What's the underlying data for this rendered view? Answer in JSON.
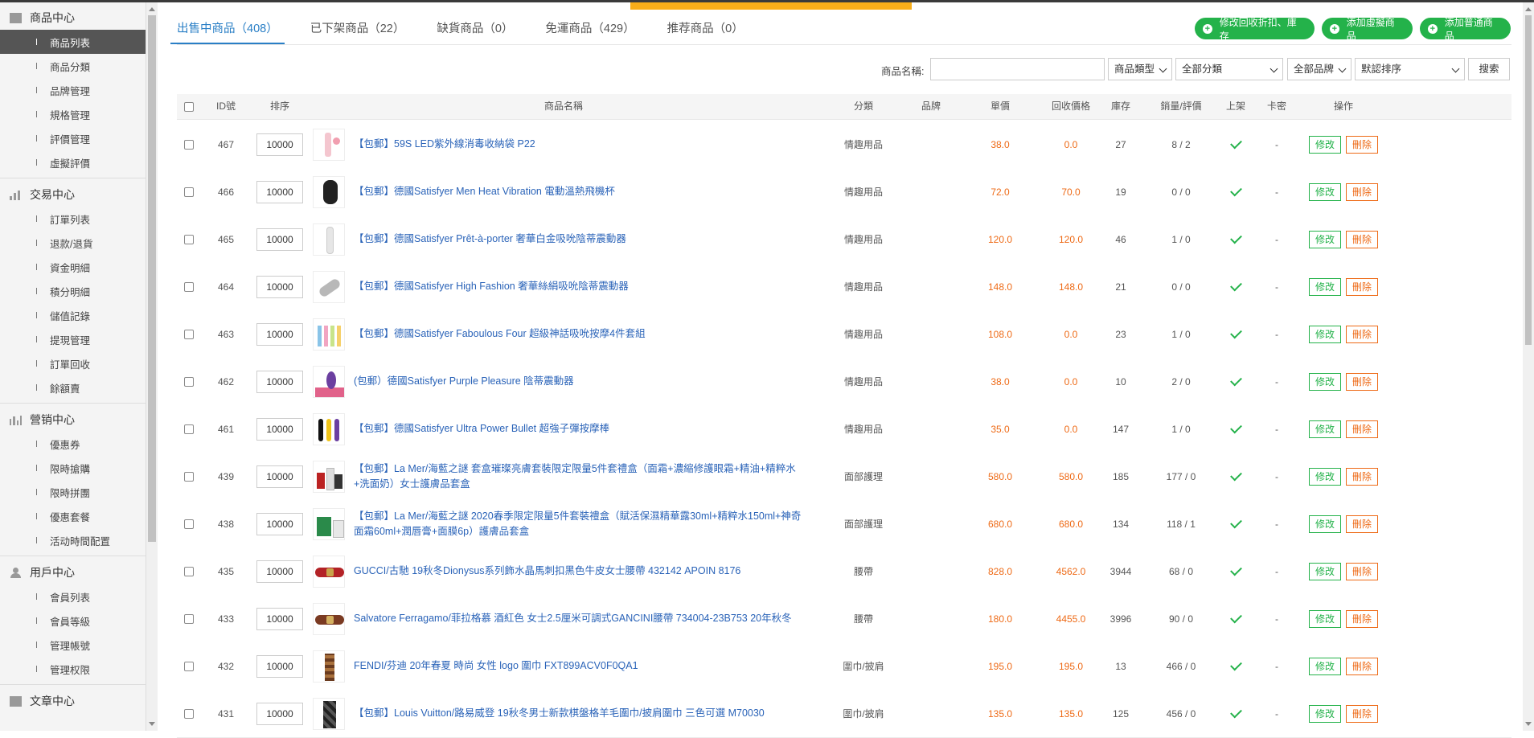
{
  "sidebar": {
    "groups": [
      {
        "title": "商品中心",
        "icon": "box-icon",
        "items": [
          "商品列表",
          "商品分類",
          "品牌管理",
          "規格管理",
          "評價管理",
          "虛擬評價"
        ],
        "active": 0
      },
      {
        "title": "交易中心",
        "icon": "bar-chart-icon",
        "items": [
          "訂單列表",
          "退款/退貨",
          "資金明細",
          "積分明細",
          "儲值記錄",
          "提現管理",
          "訂單回收",
          "餘額賣"
        ]
      },
      {
        "title": "營销中心",
        "icon": "chart-icon",
        "items": [
          "優惠券",
          "限時搶購",
          "限時拼團",
          "優惠套餐",
          "活动時間配置"
        ]
      },
      {
        "title": "用戶中心",
        "icon": "user-icon",
        "items": [
          "會員列表",
          "會員等級",
          "管理帳號",
          "管理权限"
        ]
      },
      {
        "title": "文章中心",
        "icon": "article-icon",
        "items": []
      }
    ]
  },
  "tabs": [
    {
      "label": "出售中商品（408）"
    },
    {
      "label": "已下架商品（22）"
    },
    {
      "label": "缺貨商品（0）"
    },
    {
      "label": "免運商品（429）"
    },
    {
      "label": "推荐商品（0）"
    }
  ],
  "actions": {
    "modify_recycle": "修改回收折扣、庫存",
    "add_virtual": "添加虛擬商品",
    "add_normal": "添加普通商品"
  },
  "filter": {
    "name_label": "商品名稱:",
    "name_value": "",
    "type_select": "商品類型",
    "category_select": "全部分類",
    "brand_select": "全部品牌",
    "sort_select": "默認排序",
    "search_label": "搜索"
  },
  "table": {
    "headers": {
      "id": "ID號",
      "sort": "排序",
      "name": "商品名稱",
      "category": "分類",
      "brand": "品牌",
      "price": "單價",
      "recycle": "回收價格",
      "stock": "庫存",
      "sales": "銷量/評價",
      "listed": "上架",
      "card": "卡密",
      "ops": "操作"
    },
    "edit_label": "修改",
    "delete_label": "刪除",
    "rows": [
      {
        "id": "467",
        "sort": "10000",
        "name": "【包郵】59S LED紫外線消毒收納袋 P22",
        "category": "情趣用品",
        "brand": "",
        "price": "38.0",
        "recycle": "0.0",
        "stock": "27",
        "sales": "8 / 2",
        "card": "-",
        "thumb": "pink"
      },
      {
        "id": "466",
        "sort": "10000",
        "name": "【包郵】德國Satisfyer Men Heat Vibration 電動溫熱飛機杯",
        "category": "情趣用品",
        "brand": "",
        "price": "72.0",
        "recycle": "70.0",
        "stock": "19",
        "sales": "0 / 0",
        "card": "-",
        "thumb": "black"
      },
      {
        "id": "465",
        "sort": "10000",
        "name": "【包郵】德國Satisfyer Prêt-à-porter 奢華白金吸吮陰蒂震動器",
        "category": "情趣用品",
        "brand": "",
        "price": "120.0",
        "recycle": "120.0",
        "stock": "46",
        "sales": "1 / 0",
        "card": "-",
        "thumb": "white"
      },
      {
        "id": "464",
        "sort": "10000",
        "name": "【包郵】德國Satisfyer High Fashion 奢華絲絹吸吮陰蒂震動器",
        "category": "情趣用品",
        "brand": "",
        "price": "148.0",
        "recycle": "148.0",
        "stock": "21",
        "sales": "0 / 0",
        "card": "-",
        "thumb": "silver"
      },
      {
        "id": "463",
        "sort": "10000",
        "name": "【包郵】德國Satisfyer Faboulous Four 超級神話吸吮按摩4件套組",
        "category": "情趣用品",
        "brand": "",
        "price": "108.0",
        "recycle": "0.0",
        "stock": "23",
        "sales": "1 / 0",
        "card": "-",
        "thumb": "multi"
      },
      {
        "id": "462",
        "sort": "10000",
        "name": "(包郵）德國Satisfyer Purple Pleasure 陰蒂震動器",
        "category": "情趣用品",
        "brand": "",
        "price": "38.0",
        "recycle": "0.0",
        "stock": "10",
        "sales": "2 / 0",
        "card": "-",
        "thumb": "purple"
      },
      {
        "id": "461",
        "sort": "10000",
        "name": "【包郵】德國Satisfyer Ultra Power Bullet 超強子彈按摩棒",
        "category": "情趣用品",
        "brand": "",
        "price": "35.0",
        "recycle": "0.0",
        "stock": "147",
        "sales": "1 / 0",
        "card": "-",
        "thumb": "bullet"
      },
      {
        "id": "439",
        "sort": "10000",
        "name": "【包郵】La Mer/海藍之謎 套盒璀璨亮膚套裝限定限量5件套禮盒（面霜+濃縮修護眼霜+精油+精粹水+洗面奶）女士護膚品套盒",
        "category": "面部護理",
        "brand": "",
        "price": "580.0",
        "recycle": "580.0",
        "stock": "185",
        "sales": "177 / 0",
        "card": "-",
        "thumb": "lamer"
      },
      {
        "id": "438",
        "sort": "10000",
        "name": "【包郵】La Mer/海藍之謎 2020春季限定限量5件套裝禮盒（賦活保濕精華露30ml+精粹水150ml+神奇面霜60ml+潤唇膏+面膜6p）護膚品套盒",
        "category": "面部護理",
        "brand": "",
        "price": "680.0",
        "recycle": "680.0",
        "stock": "134",
        "sales": "118 / 1",
        "card": "-",
        "thumb": "lamer2"
      },
      {
        "id": "435",
        "sort": "10000",
        "name": "GUCCI/古馳 19秋冬Dionysus系列飾水晶馬刺扣黑色牛皮女士腰帶 432142 APOIN 8176",
        "category": "腰帶",
        "brand": "",
        "price": "828.0",
        "recycle": "4562.0",
        "stock": "3944",
        "sales": "68 / 0",
        "card": "-",
        "thumb": "belt-red"
      },
      {
        "id": "433",
        "sort": "10000",
        "name": "Salvatore Ferragamo/菲拉格慕 酒紅色 女士2.5厘米可調式GANCINI腰帶 734004-23B753 20年秋冬",
        "category": "腰帶",
        "brand": "",
        "price": "180.0",
        "recycle": "4455.0",
        "stock": "3996",
        "sales": "90 / 0",
        "card": "-",
        "thumb": "belt-brown"
      },
      {
        "id": "432",
        "sort": "10000",
        "name": "FENDI/芬迪 20年春夏 時尚 女性 logo 圍巾 FXT899ACV0F0QA1",
        "category": "圍巾/披肩",
        "brand": "",
        "price": "195.0",
        "recycle": "195.0",
        "stock": "13",
        "sales": "466 / 0",
        "card": "-",
        "thumb": "scarf"
      },
      {
        "id": "431",
        "sort": "10000",
        "name": "【包郵】Louis Vuitton/路易威登 19秋冬男士新款棋盤格羊毛圍巾/披肩圍巾 三色可選 M70030",
        "category": "圍巾/披肩",
        "brand": "",
        "price": "135.0",
        "recycle": "135.0",
        "stock": "125",
        "sales": "456 / 0",
        "card": "-",
        "thumb": "scarf-dark"
      }
    ]
  }
}
